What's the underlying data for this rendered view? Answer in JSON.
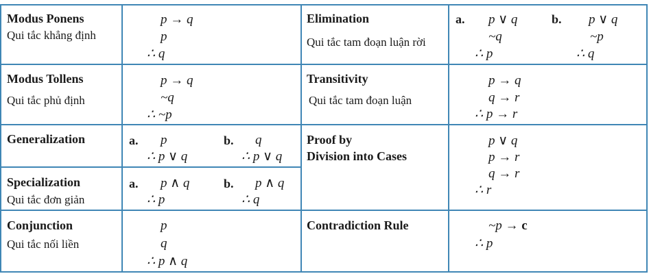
{
  "rules": {
    "modus_ponens": {
      "name": "Modus Ponens",
      "vi": "Qui tắc khẳng định",
      "lines": [
        "p → q",
        "p",
        "∴ q"
      ]
    },
    "modus_tollens": {
      "name": "Modus Tollens",
      "vi": "Qui tắc phủ định",
      "lines": [
        "p → q",
        "~q",
        "∴ ~p"
      ]
    },
    "generalization": {
      "name": "Generalization",
      "a_label": "a.",
      "a_lines": [
        "p",
        "∴ p ∨ q"
      ],
      "b_label": "b.",
      "b_lines": [
        "q",
        "∴ p ∨ q"
      ]
    },
    "specialization": {
      "name": "Specialization",
      "vi": "Qui tắc đơn giản",
      "a_label": "a.",
      "a_lines": [
        "p ∧ q",
        "∴ p"
      ],
      "b_label": "b.",
      "b_lines": [
        "p ∧ q",
        "∴ q"
      ]
    },
    "conjunction": {
      "name": "Conjunction",
      "vi": "Qui tắc nối liền",
      "lines": [
        "p",
        "q",
        "∴ p ∧ q"
      ]
    },
    "elimination": {
      "name": "Elimination",
      "vi": "Qui tắc tam đoạn luận rời",
      "a_label": "a.",
      "a_lines": [
        "p ∨ q",
        "~q",
        "∴ p"
      ],
      "b_label": "b.",
      "b_lines": [
        "p ∨ q",
        "~p",
        "∴ q"
      ]
    },
    "transitivity": {
      "name": "Transitivity",
      "vi": "Qui tắc tam đoạn luận",
      "lines": [
        "p → q",
        "q → r",
        "∴ p → r"
      ]
    },
    "proof_by_cases": {
      "name_line1": "Proof by",
      "name_line2": "Division into Cases",
      "lines": [
        "p ∨ q",
        "p → r",
        "q → r",
        "∴ r"
      ]
    },
    "contradiction": {
      "name": "Contradiction Rule",
      "line1_prefix": "~p → ",
      "line1_c": "c",
      "line2": "∴ p"
    }
  }
}
